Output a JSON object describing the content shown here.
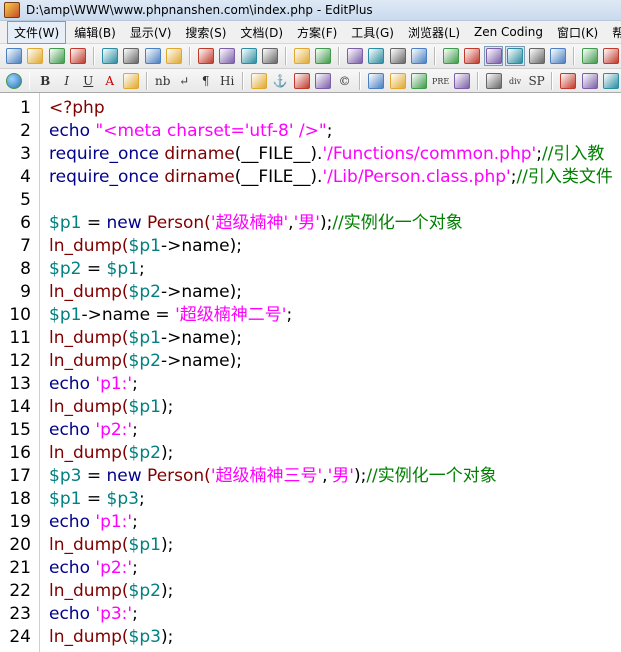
{
  "window": {
    "title": "D:\\amp\\WWW\\www.phpnanshen.com\\index.php - EditPlus"
  },
  "menu": [
    {
      "label": "文件(W)",
      "active": true
    },
    {
      "label": "编辑(B)"
    },
    {
      "label": "显示(V)"
    },
    {
      "label": "搜索(S)"
    },
    {
      "label": "文档(D)"
    },
    {
      "label": "方案(F)"
    },
    {
      "label": "工具(G)"
    },
    {
      "label": "浏览器(L)"
    },
    {
      "label": "Zen Coding"
    },
    {
      "label": "窗口(K)"
    },
    {
      "label": "帮助(H)"
    }
  ],
  "toolbar1": [
    "new-file-icon",
    "open-file-icon",
    "save-icon",
    "save-all-icon",
    "sep",
    "print-preview-icon",
    "print-icon",
    "spellcheck-icon",
    "ftp-upload-icon",
    "sep",
    "cut-icon",
    "copy-icon",
    "paste-icon",
    "delete-icon",
    "sep",
    "undo-icon",
    "redo-icon",
    "sep",
    "find-icon",
    "replace-icon",
    "find-in-files-icon",
    "goto-line-icon",
    "sep",
    "font-size-icon",
    "hex-viewer-icon",
    "word-wrap-icon",
    "ruler-icon",
    "column-select-icon",
    "check-icon",
    "sep",
    "document-list-icon",
    "output-window-icon"
  ],
  "toolbar2": [
    {
      "name": "browser-icon"
    },
    {
      "sep": true
    },
    {
      "name": "bold-icon",
      "glyph": "B"
    },
    {
      "name": "italic-icon",
      "glyph": "I"
    },
    {
      "name": "underline-icon",
      "glyph": "U"
    },
    {
      "name": "font-color-icon",
      "glyph": "A"
    },
    {
      "name": "color-palette-icon"
    },
    {
      "sep": true
    },
    {
      "name": "nbsp-icon",
      "glyph": "nb"
    },
    {
      "name": "line-break-icon",
      "glyph": "↵"
    },
    {
      "name": "paragraph-icon",
      "glyph": "¶"
    },
    {
      "name": "heading-icon",
      "glyph": "Hi"
    },
    {
      "sep": true
    },
    {
      "name": "image-icon"
    },
    {
      "name": "anchor-icon",
      "glyph": "⚓"
    },
    {
      "name": "horizontal-rule-icon"
    },
    {
      "name": "comment-icon"
    },
    {
      "name": "copyright-icon",
      "glyph": "©"
    },
    {
      "sep": true
    },
    {
      "name": "table-icon"
    },
    {
      "name": "form-icon"
    },
    {
      "name": "list-icon"
    },
    {
      "name": "pre-icon",
      "glyph": "PRE"
    },
    {
      "name": "break-icon"
    },
    {
      "sep": true
    },
    {
      "name": "text-box-icon"
    },
    {
      "name": "div-icon",
      "glyph": "div"
    },
    {
      "name": "span-icon",
      "glyph": "SP"
    },
    {
      "sep": true
    },
    {
      "name": "edit-icon"
    },
    {
      "name": "eraser-icon"
    },
    {
      "name": "misc-icon"
    }
  ],
  "colors": {
    "keyword": "#00008b",
    "function": "#800000",
    "variable": "#008080",
    "string": "#ff00ff",
    "comment": "#008000",
    "operator": "#000000",
    "builtin": "#800000",
    "tag": "#0000ff"
  },
  "code_lines": [
    [
      {
        "t": "<?php",
        "c": "function"
      }
    ],
    [
      {
        "t": "echo ",
        "c": "keyword"
      },
      {
        "t": "\"<meta charset='utf-8' />\"",
        "c": "string"
      },
      {
        "t": ";",
        "c": "operator"
      }
    ],
    [
      {
        "t": "require_once ",
        "c": "keyword"
      },
      {
        "t": "dirname",
        "c": "builtin"
      },
      {
        "t": "(__FILE__).",
        "c": "operator"
      },
      {
        "t": "'/Functions/common.php'",
        "c": "string"
      },
      {
        "t": ";",
        "c": "operator"
      },
      {
        "t": "//引入教",
        "c": "comment"
      }
    ],
    [
      {
        "t": "require_once ",
        "c": "keyword"
      },
      {
        "t": "dirname",
        "c": "builtin"
      },
      {
        "t": "(__FILE__).",
        "c": "operator"
      },
      {
        "t": "'/Lib/Person.class.php'",
        "c": "string"
      },
      {
        "t": ";",
        "c": "operator"
      },
      {
        "t": "//引入类文件",
        "c": "comment"
      }
    ],
    [],
    [
      {
        "t": "$p1",
        "c": "variable"
      },
      {
        "t": " = ",
        "c": "operator"
      },
      {
        "t": "new ",
        "c": "keyword"
      },
      {
        "t": "Person(",
        "c": "function"
      },
      {
        "t": "'超级楠神'",
        "c": "string"
      },
      {
        "t": ",",
        "c": "operator"
      },
      {
        "t": "'男'",
        "c": "string"
      },
      {
        "t": ");",
        "c": "operator"
      },
      {
        "t": "//实例化一个对象",
        "c": "comment"
      }
    ],
    [
      {
        "t": "ln_dump(",
        "c": "function"
      },
      {
        "t": "$p1",
        "c": "variable"
      },
      {
        "t": "->name);",
        "c": "operator"
      }
    ],
    [
      {
        "t": "$p2",
        "c": "variable"
      },
      {
        "t": " = ",
        "c": "operator"
      },
      {
        "t": "$p1",
        "c": "variable"
      },
      {
        "t": ";",
        "c": "operator"
      }
    ],
    [
      {
        "t": "ln_dump(",
        "c": "function"
      },
      {
        "t": "$p2",
        "c": "variable"
      },
      {
        "t": "->name);",
        "c": "operator"
      }
    ],
    [
      {
        "t": "$p1",
        "c": "variable"
      },
      {
        "t": "->name = ",
        "c": "operator"
      },
      {
        "t": "'超级楠神二号'",
        "c": "string"
      },
      {
        "t": ";",
        "c": "operator"
      }
    ],
    [
      {
        "t": "ln_dump(",
        "c": "function"
      },
      {
        "t": "$p1",
        "c": "variable"
      },
      {
        "t": "->name);",
        "c": "operator"
      }
    ],
    [
      {
        "t": "ln_dump(",
        "c": "function"
      },
      {
        "t": "$p2",
        "c": "variable"
      },
      {
        "t": "->name);",
        "c": "operator"
      }
    ],
    [
      {
        "t": "echo ",
        "c": "keyword"
      },
      {
        "t": "'p1:'",
        "c": "string"
      },
      {
        "t": ";",
        "c": "operator"
      }
    ],
    [
      {
        "t": "ln_dump(",
        "c": "function"
      },
      {
        "t": "$p1",
        "c": "variable"
      },
      {
        "t": ");",
        "c": "operator"
      }
    ],
    [
      {
        "t": "echo ",
        "c": "keyword"
      },
      {
        "t": "'p2:'",
        "c": "string"
      },
      {
        "t": ";",
        "c": "operator"
      }
    ],
    [
      {
        "t": "ln_dump(",
        "c": "function"
      },
      {
        "t": "$p2",
        "c": "variable"
      },
      {
        "t": ");",
        "c": "operator"
      }
    ],
    [
      {
        "t": "$p3",
        "c": "variable"
      },
      {
        "t": " = ",
        "c": "operator"
      },
      {
        "t": "new ",
        "c": "keyword"
      },
      {
        "t": "Person(",
        "c": "function"
      },
      {
        "t": "'超级楠神三号'",
        "c": "string"
      },
      {
        "t": ",",
        "c": "operator"
      },
      {
        "t": "'男'",
        "c": "string"
      },
      {
        "t": ");",
        "c": "operator"
      },
      {
        "t": "//实例化一个对象",
        "c": "comment"
      }
    ],
    [
      {
        "t": "$p1",
        "c": "variable"
      },
      {
        "t": " = ",
        "c": "operator"
      },
      {
        "t": "$p3",
        "c": "variable"
      },
      {
        "t": ";",
        "c": "operator"
      }
    ],
    [
      {
        "t": "echo ",
        "c": "keyword"
      },
      {
        "t": "'p1:'",
        "c": "string"
      },
      {
        "t": ";",
        "c": "operator"
      }
    ],
    [
      {
        "t": "ln_dump(",
        "c": "function"
      },
      {
        "t": "$p1",
        "c": "variable"
      },
      {
        "t": ");",
        "c": "operator"
      }
    ],
    [
      {
        "t": "echo ",
        "c": "keyword"
      },
      {
        "t": "'p2:'",
        "c": "string"
      },
      {
        "t": ";",
        "c": "operator"
      }
    ],
    [
      {
        "t": "ln_dump(",
        "c": "function"
      },
      {
        "t": "$p2",
        "c": "variable"
      },
      {
        "t": ");",
        "c": "operator"
      }
    ],
    [
      {
        "t": "echo ",
        "c": "keyword"
      },
      {
        "t": "'p3:'",
        "c": "string"
      },
      {
        "t": ";",
        "c": "operator"
      }
    ],
    [
      {
        "t": "ln_dump(",
        "c": "function"
      },
      {
        "t": "$p3",
        "c": "variable"
      },
      {
        "t": ");",
        "c": "operator"
      }
    ]
  ],
  "line_numbers": [
    "1",
    "2",
    "3",
    "4",
    "5",
    "6",
    "7",
    "8",
    "9",
    "10",
    "11",
    "12",
    "13",
    "14",
    "15",
    "16",
    "17",
    "18",
    "19",
    "20",
    "21",
    "22",
    "23",
    "24"
  ]
}
